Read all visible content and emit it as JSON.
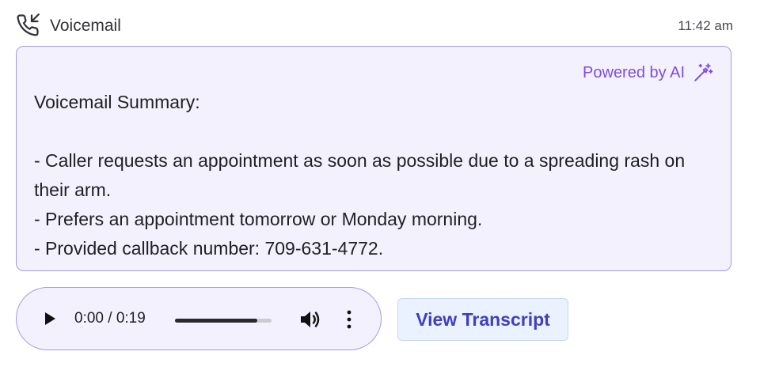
{
  "header": {
    "icon": "phone-incoming-icon",
    "title": "Voicemail",
    "time": "11:42 am"
  },
  "summary": {
    "badge": "Powered by AI",
    "badge_icon": "magic-wand-icon",
    "text": "Voicemail Summary:\n\n- Caller requests an appointment as soon as possible due to a spreading rash on their arm.\n- Prefers an appointment tomorrow or Monday morning.\n- Provided callback number: 709-631-4772."
  },
  "player": {
    "time_display": "0:00 / 0:19",
    "progress_fraction": 0.85,
    "icons": [
      "play-icon",
      "volume-icon",
      "more-vertical-icon"
    ]
  },
  "actions": {
    "view_transcript": "View Transcript"
  },
  "colors": {
    "accent_purple": "#7e4ce6",
    "card_border": "#a796ec",
    "card_background": "#f4f1fe",
    "button_text": "#3f3fbf",
    "button_background": "#eaf2ff"
  }
}
